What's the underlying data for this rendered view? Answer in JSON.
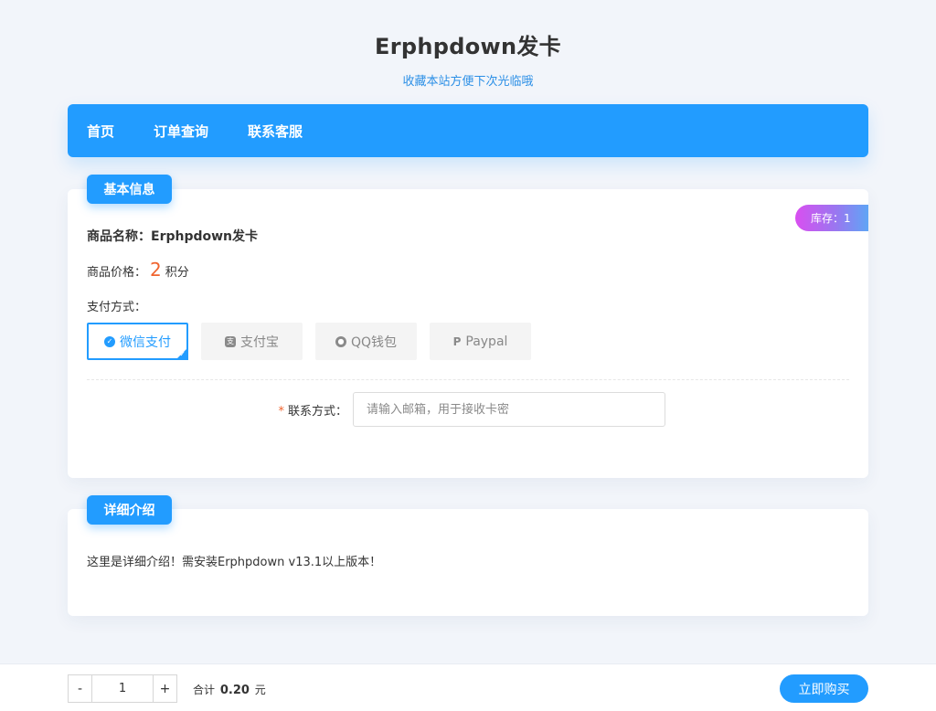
{
  "header": {
    "title": "Erphpdown发卡",
    "subtitle": "收藏本站方便下次光临哦"
  },
  "nav": {
    "items": [
      {
        "label": "首页"
      },
      {
        "label": "订单查询"
      },
      {
        "label": "联系客服"
      }
    ]
  },
  "basic_info": {
    "tab_label": "基本信息",
    "stock_label": "库存：",
    "stock_value": "1",
    "product_name_label": "商品名称：",
    "product_name": "Erphpdown发卡",
    "price_label": "商品价格：",
    "price_value": "2",
    "price_unit": "积分",
    "pay_method_label": "支付方式：",
    "pay_methods": [
      {
        "label": "微信支付",
        "icon": "wechat-icon",
        "selected": true
      },
      {
        "label": "支付宝",
        "icon": "alipay-icon",
        "selected": false
      },
      {
        "label": "QQ钱包",
        "icon": "qq-icon",
        "selected": false
      },
      {
        "label": "Paypal",
        "icon": "paypal-icon",
        "selected": false
      }
    ],
    "contact_required_mark": "*",
    "contact_label": "联系方式：",
    "contact_value": "",
    "contact_placeholder": "请输入邮箱，用于接收卡密"
  },
  "detail": {
    "tab_label": "详细介绍",
    "text": "这里是详细介绍！需安装Erphpdown v13.1以上版本！"
  },
  "bottom_bar": {
    "minus_label": "-",
    "plus_label": "+",
    "quantity": "1",
    "total_label": "合计",
    "total_amount": "0.20",
    "total_unit": "元",
    "buy_label": "立即购买"
  },
  "colors": {
    "accent": "#229cff",
    "price": "#f0642f",
    "background": "#f2f5fa"
  }
}
